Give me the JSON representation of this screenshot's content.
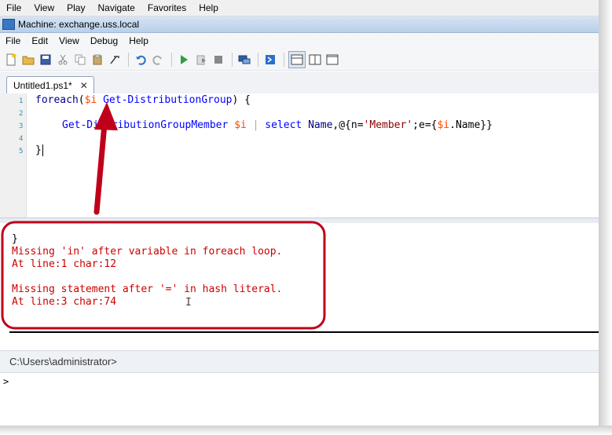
{
  "host_menu": [
    "File",
    "View",
    "Play",
    "Navigate",
    "Favorites",
    "Help"
  ],
  "window_title": "Machine: exchange.uss.local",
  "app_menu": [
    "File",
    "Edit",
    "View",
    "Debug",
    "Help"
  ],
  "toolbar_icons": [
    "new-file-icon",
    "open-folder-icon",
    "save-icon",
    "cut-icon",
    "copy-icon",
    "paste-icon",
    "clear-icon",
    "undo-icon",
    "redo-icon",
    "run-icon",
    "run-selection-icon",
    "stop-icon",
    "remote-session-icon",
    "powershell-icon",
    "layout-top-icon",
    "layout-side-icon",
    "layout-max-icon"
  ],
  "tab": {
    "label": "Untitled1.ps1*",
    "close": "✕"
  },
  "editor": {
    "line_numbers": [
      "1",
      "2",
      "3",
      "4",
      "5"
    ],
    "line1": {
      "kw": "foreach",
      "p1": "(",
      "var": "$i",
      "sp": " ",
      "cmd": "Get-DistributionGroup",
      "p2": ") {"
    },
    "line3": {
      "cmd": "Get-DistributionGroupMember",
      "var": "$i",
      "pipe": "|",
      "cmd2": "select",
      "prm": "Name",
      "rest1": ",@{n=",
      "str": "'Member'",
      "rest2": ";e={",
      "var2": "$i",
      "rest3": ".Name}}"
    },
    "line5": "}"
  },
  "output": {
    "line1": "}",
    "line2": "Missing 'in' after variable in foreach loop.",
    "line3": "At line:1 char:12",
    "line4": "Missing statement after '=' in hash literal.",
    "line5": "At line:3 char:74"
  },
  "command_pane": {
    "path": "C:\\Users\\administrator>",
    "prompt": ">"
  },
  "colors": {
    "annotation": "#c0001a",
    "error_text": "#cc0000",
    "keyword": "#00008b",
    "variable": "#ff4500",
    "command": "#0000ff",
    "string": "#8b0000"
  }
}
